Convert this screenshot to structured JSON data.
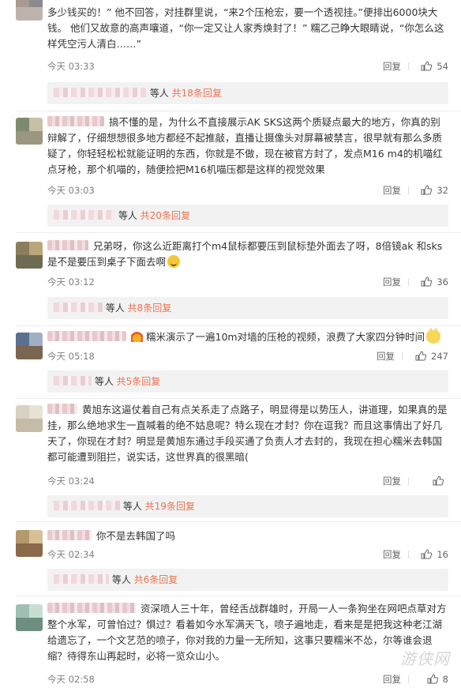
{
  "comments": [
    {
      "text_pre": "",
      "text": "多少钱买的！” 他不回答，对挂群里说，“来2个压枪宏，要一个透视挂。”便排出6000块大钱。 他们又故意的高声嚷道，“你一定又让人家秀焕封了！” 糯乙己睁大眼睛说，“你怎么这样凭空污人清白……”",
      "time": "今天 03:33",
      "reply_label": "回复",
      "likes": "54",
      "thread_tail": "等人",
      "thread_more": "共18条回复"
    },
    {
      "text": "搞不懂的是，为什么不直接展示AK SKS这两个质疑点最大的地方，你真的别辩解了，仔细想想很多地方都经不起推敲，直播让摄像头对屏幕被禁言，很早就有那么多质疑了，你轻轻松松就能证明的东西，你就是不做，现在被官方封了，发点M16 m4的机喵红点牙枪，那个机喵的，随便捡把M16机喵压都是这样的视觉效果",
      "time": "今天 03:03",
      "reply_label": "回复",
      "likes": "32",
      "thread_tail": "等人",
      "thread_more": "共20条回复"
    },
    {
      "text": "兄弟呀，你这么近距离打个m4鼠标都要压到鼠标垫外面去了呀，8倍镜ak 和sks 是不是要压到桌子下面去啊",
      "time": "今天 03:12",
      "reply_label": "回复",
      "likes": "36",
      "thread_tail": "等人",
      "thread_more": "共8条回复"
    },
    {
      "text": "糯米演示了一遍10m对墙的压枪的视频，浪费了大家四分钟时间",
      "time": "今天 05:18",
      "reply_label": "回复",
      "likes": "247",
      "thread_tail": "等人",
      "thread_more": "共5条回复"
    },
    {
      "text": "黄旭东这逼仗着自己有点关系走了点路子，明显得是以势压人，讲道理，如果真的是挂，那么绝地求生一直喊着的绝不姑息呢？特么现在才封？你在逗我？而且这事情出了好几天了，你现在才封？明显是黄旭东通过手段买通了负责人才去封的，我现在担心糯米去韩国都可能遭到阻拦，说实话，这世界真的很黑暗(",
      "time": "今天 03:24",
      "reply_label": "回复",
      "likes": "",
      "thread_tail": "等人",
      "thread_more": "共19条回复"
    },
    {
      "text": "你不是去韩国了吗",
      "time": "今天 02:34",
      "reply_label": "回复",
      "likes": "16",
      "thread_tail": "等人",
      "thread_more": "共6条回复"
    },
    {
      "text": "资深喷人三十年，曾经舌战群雄时，开局一人一条狗坐在网吧点草对方整个水军，可曾怕过？惧过？看着如今水军满天飞，喷子遍地走，看来是是把我这种老江湖给遗忘了，一个文艺范的喷子，你对我的力量一无所知，这事只要糯米不怂，尔等谁会退缩？待得东山再起时，必将一览众山小。",
      "time": "今天 02:58",
      "reply_label": "回复",
      "likes": "8",
      "thread_tail": "",
      "thread_more": ""
    }
  ],
  "watermark": "游侠网",
  "colors": {
    "accent": "#eb7350",
    "meta": "#808080",
    "subbar": "#f2f2f2"
  },
  "icons": {
    "like": "thumbs-up-icon",
    "emoji_grin": "grin-emoji-icon",
    "emoji_cat": "cat-emoji-icon",
    "badge": "fire-badge-icon"
  }
}
